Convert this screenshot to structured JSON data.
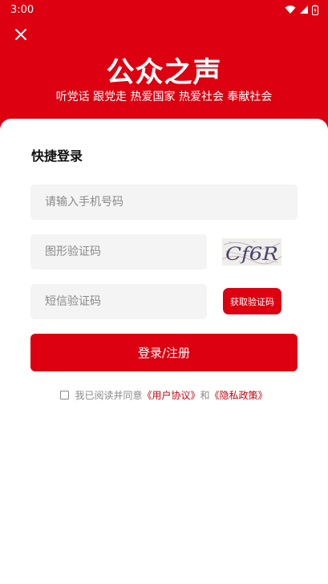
{
  "status_bar": {
    "time": "3:00"
  },
  "header": {
    "title": "公众之声",
    "slogan": "听党话 跟党走 热爱国家 热爱社会 奉献社会"
  },
  "login": {
    "title": "快捷登录",
    "phone_placeholder": "请输入手机号码",
    "captcha_placeholder": "图形验证码",
    "captcha_text": "Cf6R",
    "sms_placeholder": "短信验证码",
    "sms_button": "获取验证码",
    "submit_button": "登录/注册"
  },
  "agreement": {
    "prefix": "我已阅读并同意",
    "user_agreement": "《用户协议》",
    "and": "和",
    "privacy_policy": "《隐私政策》"
  },
  "colors": {
    "brand_red": "#dc0010",
    "input_bg": "#f4f4f4"
  }
}
